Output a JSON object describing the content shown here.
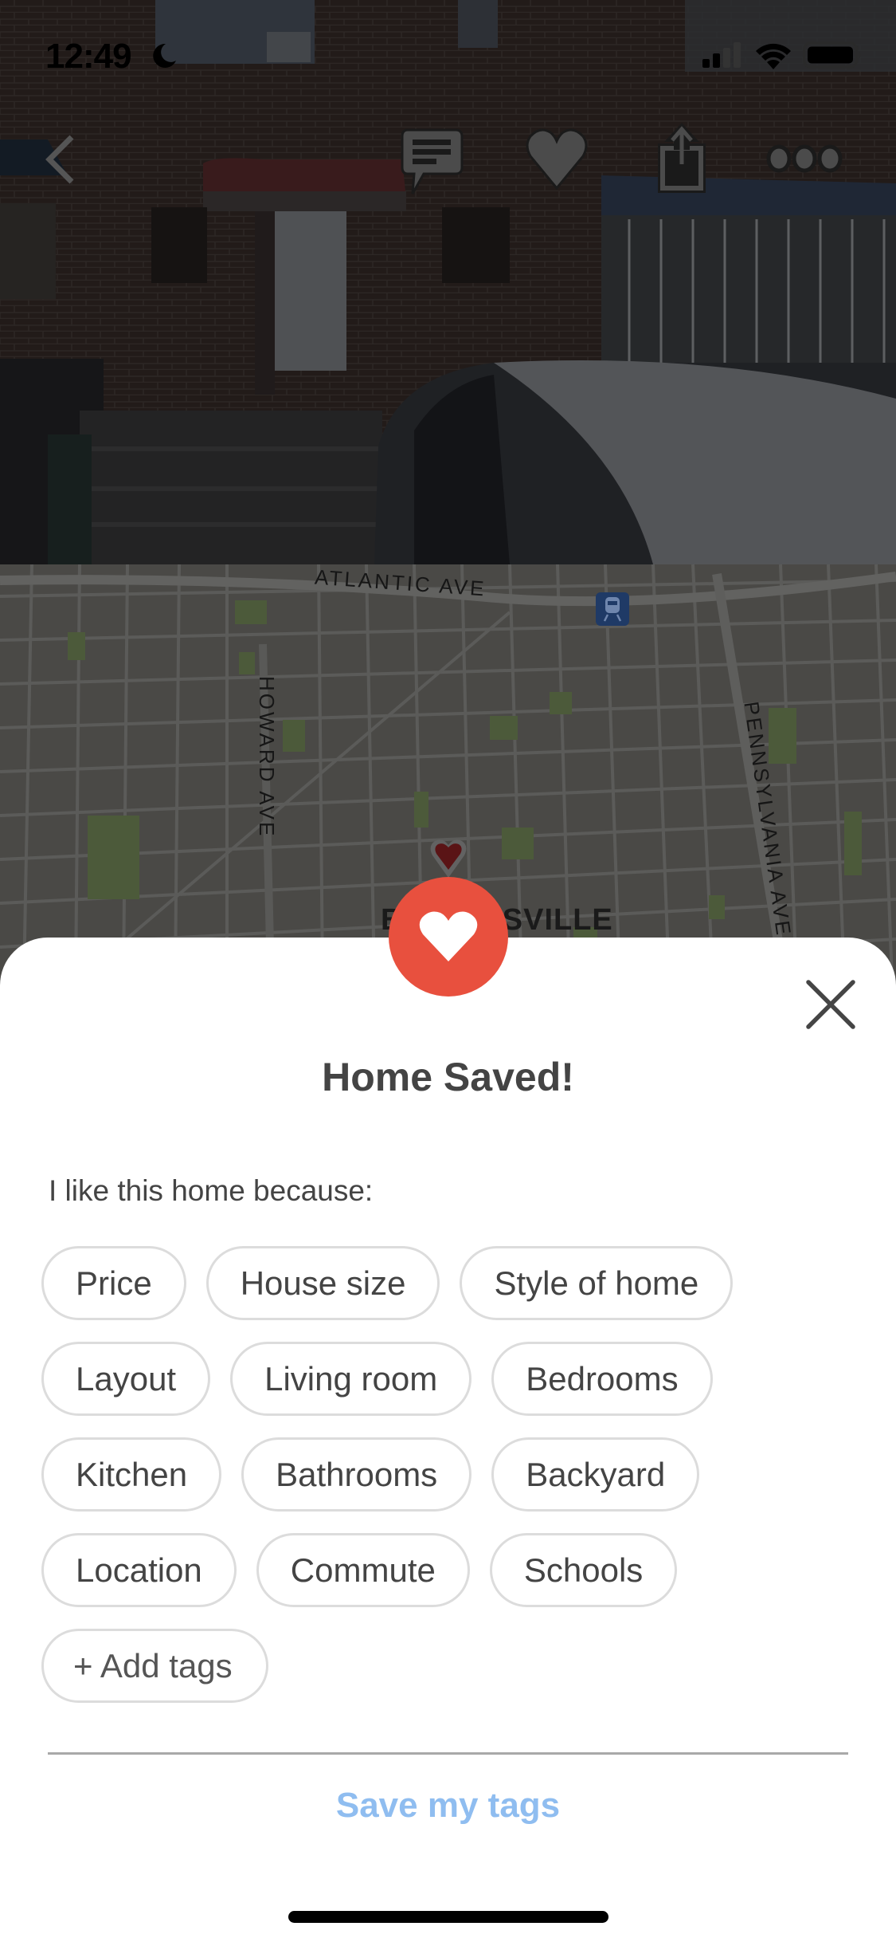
{
  "status_bar": {
    "time": "12:49",
    "focus_icon": "moon-icon",
    "signal_bars_filled": 2,
    "signal_bars_total": 4,
    "wifi_icon": "wifi-icon",
    "battery_icon": "battery-icon"
  },
  "nav_bar": {
    "back_icon": "chevron-left-icon",
    "actions": [
      {
        "name": "comment",
        "icon": "comment-icon"
      },
      {
        "name": "favorite",
        "icon": "heart-icon"
      },
      {
        "name": "share",
        "icon": "share-icon"
      },
      {
        "name": "more",
        "icon": "more-dots-icon"
      }
    ]
  },
  "map": {
    "streets": [
      "ATLANTIC AVE",
      "HOWARD AVE",
      "PENNSYLVANIA AVE"
    ],
    "neighborhood": "BROWNSVILLE",
    "transit_icon": "train-icon",
    "pin_icon": "heart-pin-icon"
  },
  "sheet": {
    "badge_icon": "heart-icon",
    "close_icon": "close-icon",
    "title": "Home Saved!",
    "prompt": "I like this home because:",
    "tags": [
      "Price",
      "House size",
      "Style of home",
      "Layout",
      "Living room",
      "Bedrooms",
      "Kitchen",
      "Bathrooms",
      "Backyard",
      "Location",
      "Commute",
      "Schools"
    ],
    "add_tags_label": "+ Add tags",
    "save_label": "Save my tags"
  },
  "colors": {
    "accent_red": "#E8503E",
    "link_blue": "#8FBDF0",
    "text_dark": "#444444",
    "tag_border": "#DCDCDC",
    "transit_navy": "#1F3A66"
  }
}
